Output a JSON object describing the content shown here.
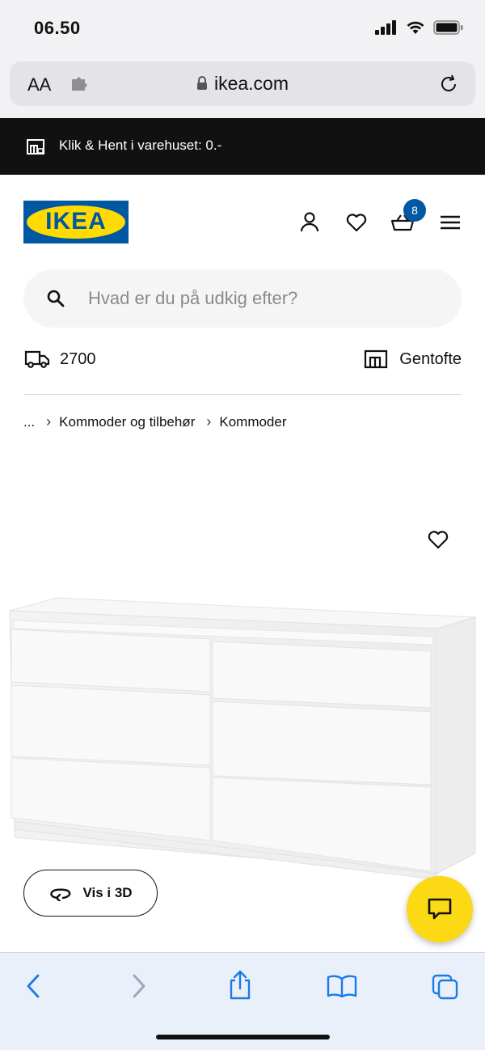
{
  "status_bar": {
    "time": "06.50"
  },
  "browser": {
    "text_size_label": "AA",
    "domain": "ikea.com"
  },
  "promo": {
    "text": "Klik & Hent i varehuset: 0.-"
  },
  "header": {
    "logo_text": "IKEA",
    "cart_count": "8"
  },
  "search": {
    "placeholder": "Hvad er du på udkig efter?"
  },
  "delivery": {
    "postcode": "2700",
    "store": "Gentofte"
  },
  "breadcrumb": {
    "ellipsis": "...",
    "items": [
      "Kommoder og tilbehør",
      "Kommoder"
    ]
  },
  "product": {
    "view_3d_label": "Vis i 3D"
  },
  "icons": {
    "extension": "puzzle-icon",
    "lock": "lock-icon",
    "reload": "reload-icon",
    "store": "store-icon",
    "user": "user-icon",
    "heart": "heart-icon",
    "cart": "basket-icon",
    "menu": "hamburger-menu-icon",
    "search": "search-icon",
    "truck": "truck-icon",
    "rotate": "rotate-3d-icon",
    "chat": "chat-icon",
    "back": "chevron-left-icon",
    "forward": "chevron-right-icon",
    "share": "share-icon",
    "bookmarks": "book-icon",
    "tabs": "tabs-icon"
  },
  "colors": {
    "brand_blue": "#0058a3",
    "brand_yellow": "#ffdb00",
    "chat_yellow": "#fbd914",
    "safari_blue": "#1a7ae8"
  }
}
